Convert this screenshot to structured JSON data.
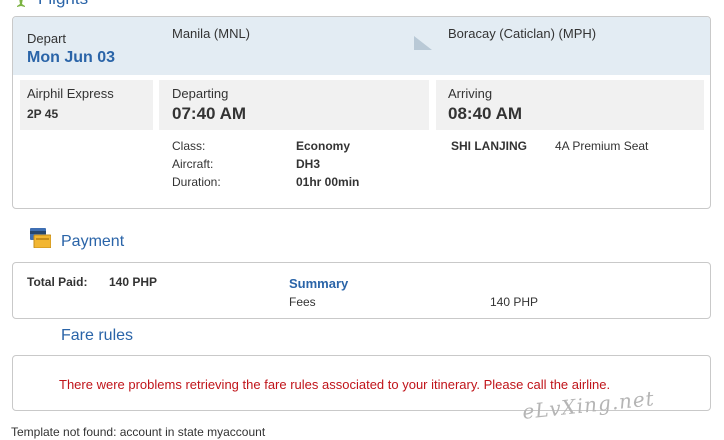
{
  "flights_section": {
    "title": "Flights",
    "icon": "plane-icon"
  },
  "route": {
    "depart_label": "Depart",
    "date": "Mon Jun 03",
    "origin": "Manila (MNL)",
    "destination": "Boracay (Caticlan) (MPH)"
  },
  "segment": {
    "airline": "Airphil Express",
    "flight_number": "2P 45",
    "departing_label": "Departing",
    "departing_time": "07:40 AM",
    "arriving_label": "Arriving",
    "arriving_time": "08:40 AM",
    "class_label": "Class:",
    "class_value": "Economy",
    "aircraft_label": "Aircraft:",
    "aircraft_value": "DH3",
    "duration_label": "Duration:",
    "duration_value": "01hr 00min",
    "passenger_name": "SHI LANJING",
    "seat": "4A Premium Seat"
  },
  "payment": {
    "title": "Payment",
    "icon": "payment-card-icon",
    "total_paid_label": "Total Paid:",
    "total_paid_value": "140 PHP",
    "summary_label": "Summary",
    "fees_label": "Fees",
    "fees_value": "140 PHP"
  },
  "fare_rules": {
    "title": "Fare rules",
    "error_message": "There were problems retrieving the fare rules associated to your itinerary. Please call the airline."
  },
  "footer_message": "Template not found: account in state myaccount",
  "watermark": "eLvXing.net",
  "colors": {
    "link_blue": "#2a64a8",
    "error_red": "#c0141a",
    "route_bg": "#e3ecf3",
    "box_bg": "#f1f1f1"
  }
}
